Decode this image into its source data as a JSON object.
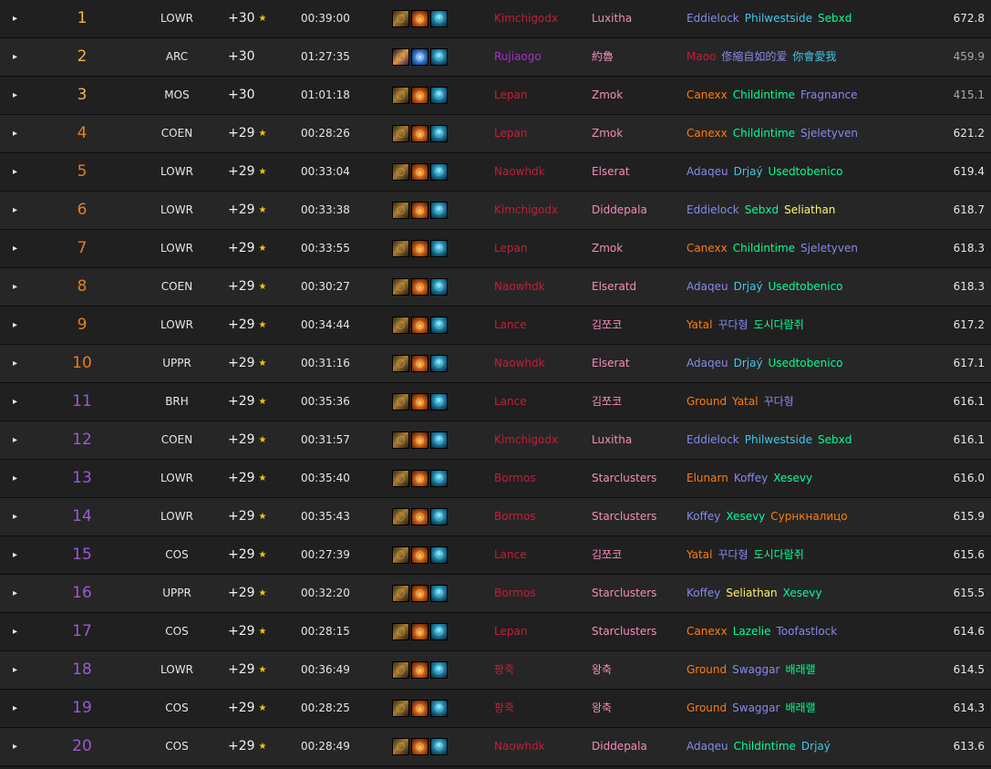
{
  "colors": {
    "rank_1": "#f5b041",
    "rank_2": "#e67e22",
    "rank_3": "#8e44ad",
    "deathknight": "#c41e3a",
    "demonhunter": "#a330c9",
    "warrior": "#c69b6d",
    "paladin": "#f48cba",
    "monk": "#00ff98",
    "druid": "#ff7c0a",
    "warlock": "#8788ee",
    "mage": "#3fc7eb",
    "priest": "#ffffff",
    "evoker": "#33937f",
    "shaman": "#0070dd",
    "rogue": "#fff468",
    "hunter": "#aad372"
  },
  "rows": [
    {
      "rank": "1",
      "rank_color": "#f0b44a",
      "dungeon": "LOWR",
      "level": "+30",
      "timed": true,
      "time": "00:39:00",
      "affix_set": "a",
      "tank": "Kimchigodx",
      "tank_color": "#c41e3a",
      "healer": "Luxitha",
      "healer_color": "#f48cba",
      "dps": [
        {
          "name": "Eddielock",
          "color": "#8788ee"
        },
        {
          "name": "Philwestside",
          "color": "#3fc7eb"
        },
        {
          "name": "Sebxd",
          "color": "#00ff98"
        }
      ],
      "score": "672.8",
      "score_dim": false
    },
    {
      "rank": "2",
      "rank_color": "#f0b44a",
      "dungeon": "ARC",
      "level": "+30",
      "timed": false,
      "time": "01:27:35",
      "affix_set": "b",
      "tank": "Rujiaogo",
      "tank_color": "#a330c9",
      "healer": "約魯",
      "healer_color": "#f48cba",
      "dps": [
        {
          "name": "Maoo",
          "color": "#c41e3a"
        },
        {
          "name": "俢縮自如的爱",
          "color": "#8788ee"
        },
        {
          "name": "你會愛我",
          "color": "#3fc7eb"
        }
      ],
      "score": "459.9",
      "score_dim": true
    },
    {
      "rank": "3",
      "rank_color": "#f0b44a",
      "dungeon": "MOS",
      "level": "+30",
      "timed": false,
      "time": "01:01:18",
      "affix_set": "a",
      "tank": "Lepan",
      "tank_color": "#c41e3a",
      "healer": "Zmok",
      "healer_color": "#f48cba",
      "dps": [
        {
          "name": "Canexx",
          "color": "#ff7c0a"
        },
        {
          "name": "Childintime",
          "color": "#00ff98"
        },
        {
          "name": "Fragnance",
          "color": "#8788ee"
        }
      ],
      "score": "415.1",
      "score_dim": true
    },
    {
      "rank": "4",
      "rank_color": "#e67e22",
      "dungeon": "COEN",
      "level": "+29",
      "timed": true,
      "time": "00:28:26",
      "affix_set": "a",
      "tank": "Lepan",
      "tank_color": "#c41e3a",
      "healer": "Zmok",
      "healer_color": "#f48cba",
      "dps": [
        {
          "name": "Canexx",
          "color": "#ff7c0a"
        },
        {
          "name": "Childintime",
          "color": "#00ff98"
        },
        {
          "name": "Sjeletyven",
          "color": "#8788ee"
        }
      ],
      "score": "621.2",
      "score_dim": false
    },
    {
      "rank": "5",
      "rank_color": "#e67e22",
      "dungeon": "LOWR",
      "level": "+29",
      "timed": true,
      "time": "00:33:04",
      "affix_set": "a",
      "tank": "Naowhdk",
      "tank_color": "#c41e3a",
      "healer": "Elserat",
      "healer_color": "#f48cba",
      "dps": [
        {
          "name": "Adaqeu",
          "color": "#8788ee"
        },
        {
          "name": "Drjaý",
          "color": "#3fc7eb"
        },
        {
          "name": "Usedtobenico",
          "color": "#00ff98"
        }
      ],
      "score": "619.4",
      "score_dim": false
    },
    {
      "rank": "6",
      "rank_color": "#e67e22",
      "dungeon": "LOWR",
      "level": "+29",
      "timed": true,
      "time": "00:33:38",
      "affix_set": "a",
      "tank": "Kimchigodx",
      "tank_color": "#c41e3a",
      "healer": "Diddepala",
      "healer_color": "#f48cba",
      "dps": [
        {
          "name": "Eddielock",
          "color": "#8788ee"
        },
        {
          "name": "Sebxd",
          "color": "#00ff98"
        },
        {
          "name": "Seliathan",
          "color": "#fff468"
        }
      ],
      "score": "618.7",
      "score_dim": false
    },
    {
      "rank": "7",
      "rank_color": "#e67e22",
      "dungeon": "LOWR",
      "level": "+29",
      "timed": true,
      "time": "00:33:55",
      "affix_set": "a",
      "tank": "Lepan",
      "tank_color": "#c41e3a",
      "healer": "Zmok",
      "healer_color": "#f48cba",
      "dps": [
        {
          "name": "Canexx",
          "color": "#ff7c0a"
        },
        {
          "name": "Childintime",
          "color": "#00ff98"
        },
        {
          "name": "Sjeletyven",
          "color": "#8788ee"
        }
      ],
      "score": "618.3",
      "score_dim": false
    },
    {
      "rank": "8",
      "rank_color": "#e67e22",
      "dungeon": "COEN",
      "level": "+29",
      "timed": true,
      "time": "00:30:27",
      "affix_set": "a",
      "tank": "Naowhdk",
      "tank_color": "#c41e3a",
      "healer": "Elseratd",
      "healer_color": "#f48cba",
      "dps": [
        {
          "name": "Adaqeu",
          "color": "#8788ee"
        },
        {
          "name": "Drjaý",
          "color": "#3fc7eb"
        },
        {
          "name": "Usedtobenico",
          "color": "#00ff98"
        }
      ],
      "score": "618.3",
      "score_dim": false
    },
    {
      "rank": "9",
      "rank_color": "#e67e22",
      "dungeon": "LOWR",
      "level": "+29",
      "timed": true,
      "time": "00:34:44",
      "affix_set": "a",
      "tank": "Lance",
      "tank_color": "#c41e3a",
      "healer": "김쪼코",
      "healer_color": "#f48cba",
      "dps": [
        {
          "name": "Yatal",
          "color": "#ff7c0a"
        },
        {
          "name": "꾸다형",
          "color": "#8788ee"
        },
        {
          "name": "도시다람쥐",
          "color": "#00ff98"
        }
      ],
      "score": "617.2",
      "score_dim": false
    },
    {
      "rank": "10",
      "rank_color": "#e67e22",
      "dungeon": "UPPR",
      "level": "+29",
      "timed": true,
      "time": "00:31:16",
      "affix_set": "a",
      "tank": "Naowhdk",
      "tank_color": "#c41e3a",
      "healer": "Elserat",
      "healer_color": "#f48cba",
      "dps": [
        {
          "name": "Adaqeu",
          "color": "#8788ee"
        },
        {
          "name": "Drjaý",
          "color": "#3fc7eb"
        },
        {
          "name": "Usedtobenico",
          "color": "#00ff98"
        }
      ],
      "score": "617.1",
      "score_dim": false
    },
    {
      "rank": "11",
      "rank_color": "#9b59d6",
      "dungeon": "BRH",
      "level": "+29",
      "timed": true,
      "time": "00:35:36",
      "affix_set": "a",
      "tank": "Lance",
      "tank_color": "#c41e3a",
      "healer": "김쪼코",
      "healer_color": "#f48cba",
      "dps": [
        {
          "name": "Ground",
          "color": "#ff7c0a"
        },
        {
          "name": "Yatal",
          "color": "#ff7c0a"
        },
        {
          "name": "꾸다형",
          "color": "#8788ee"
        }
      ],
      "score": "616.1",
      "score_dim": false
    },
    {
      "rank": "12",
      "rank_color": "#9b59d6",
      "dungeon": "COEN",
      "level": "+29",
      "timed": true,
      "time": "00:31:57",
      "affix_set": "a",
      "tank": "Kimchigodx",
      "tank_color": "#c41e3a",
      "healer": "Luxitha",
      "healer_color": "#f48cba",
      "dps": [
        {
          "name": "Eddielock",
          "color": "#8788ee"
        },
        {
          "name": "Philwestside",
          "color": "#3fc7eb"
        },
        {
          "name": "Sebxd",
          "color": "#00ff98"
        }
      ],
      "score": "616.1",
      "score_dim": false
    },
    {
      "rank": "13",
      "rank_color": "#9b59d6",
      "dungeon": "LOWR",
      "level": "+29",
      "timed": true,
      "time": "00:35:40",
      "affix_set": "a",
      "tank": "Bormos",
      "tank_color": "#c41e3a",
      "healer": "Starclusters",
      "healer_color": "#f48cba",
      "dps": [
        {
          "name": "Elunarn",
          "color": "#ff7c0a"
        },
        {
          "name": "Koffey",
          "color": "#8788ee"
        },
        {
          "name": "Xesevy",
          "color": "#00ff98"
        }
      ],
      "score": "616.0",
      "score_dim": false
    },
    {
      "rank": "14",
      "rank_color": "#9b59d6",
      "dungeon": "LOWR",
      "level": "+29",
      "timed": true,
      "time": "00:35:43",
      "affix_set": "a",
      "tank": "Bormos",
      "tank_color": "#c41e3a",
      "healer": "Starclusters",
      "healer_color": "#f48cba",
      "dps": [
        {
          "name": "Koffey",
          "color": "#8788ee"
        },
        {
          "name": "Xesevy",
          "color": "#00ff98"
        },
        {
          "name": "Сурнкналицо",
          "color": "#ff7c0a"
        }
      ],
      "score": "615.9",
      "score_dim": false
    },
    {
      "rank": "15",
      "rank_color": "#9b59d6",
      "dungeon": "COS",
      "level": "+29",
      "timed": true,
      "time": "00:27:39",
      "affix_set": "a",
      "tank": "Lance",
      "tank_color": "#c41e3a",
      "healer": "김쪼코",
      "healer_color": "#f48cba",
      "dps": [
        {
          "name": "Yatal",
          "color": "#ff7c0a"
        },
        {
          "name": "꾸다형",
          "color": "#8788ee"
        },
        {
          "name": "도시다람쥐",
          "color": "#00ff98"
        }
      ],
      "score": "615.6",
      "score_dim": false
    },
    {
      "rank": "16",
      "rank_color": "#9b59d6",
      "dungeon": "UPPR",
      "level": "+29",
      "timed": true,
      "time": "00:32:20",
      "affix_set": "a",
      "tank": "Bormos",
      "tank_color": "#c41e3a",
      "healer": "Starclusters",
      "healer_color": "#f48cba",
      "dps": [
        {
          "name": "Koffey",
          "color": "#8788ee"
        },
        {
          "name": "Seliathan",
          "color": "#fff468"
        },
        {
          "name": "Xesevy",
          "color": "#00ff98"
        }
      ],
      "score": "615.5",
      "score_dim": false
    },
    {
      "rank": "17",
      "rank_color": "#9b59d6",
      "dungeon": "COS",
      "level": "+29",
      "timed": true,
      "time": "00:28:15",
      "affix_set": "a",
      "tank": "Lepan",
      "tank_color": "#c41e3a",
      "healer": "Starclusters",
      "healer_color": "#f48cba",
      "dps": [
        {
          "name": "Canexx",
          "color": "#ff7c0a"
        },
        {
          "name": "Lazelie",
          "color": "#00ff98"
        },
        {
          "name": "Toofastlock",
          "color": "#8788ee"
        }
      ],
      "score": "614.6",
      "score_dim": false
    },
    {
      "rank": "18",
      "rank_color": "#9b59d6",
      "dungeon": "LOWR",
      "level": "+29",
      "timed": true,
      "time": "00:36:49",
      "affix_set": "a",
      "tank": "팡죽",
      "tank_color": "#c41e3a",
      "healer": "왕축",
      "healer_color": "#f48cba",
      "dps": [
        {
          "name": "Ground",
          "color": "#ff7c0a"
        },
        {
          "name": "Swaggar",
          "color": "#8788ee"
        },
        {
          "name": "배래랠",
          "color": "#00ff98"
        }
      ],
      "score": "614.5",
      "score_dim": false
    },
    {
      "rank": "19",
      "rank_color": "#9b59d6",
      "dungeon": "COS",
      "level": "+29",
      "timed": true,
      "time": "00:28:25",
      "affix_set": "a",
      "tank": "팡죽",
      "tank_color": "#c41e3a",
      "healer": "왕축",
      "healer_color": "#f48cba",
      "dps": [
        {
          "name": "Ground",
          "color": "#ff7c0a"
        },
        {
          "name": "Swaggar",
          "color": "#8788ee"
        },
        {
          "name": "배래랠",
          "color": "#00ff98"
        }
      ],
      "score": "614.3",
      "score_dim": false
    },
    {
      "rank": "20",
      "rank_color": "#9b59d6",
      "dungeon": "COS",
      "level": "+29",
      "timed": true,
      "time": "00:28:49",
      "affix_set": "a",
      "tank": "Naowhdk",
      "tank_color": "#c41e3a",
      "healer": "Diddepala",
      "healer_color": "#f48cba",
      "dps": [
        {
          "name": "Adaqeu",
          "color": "#8788ee"
        },
        {
          "name": "Childintime",
          "color": "#00ff98"
        },
        {
          "name": "Drjaý",
          "color": "#3fc7eb"
        }
      ],
      "score": "613.6",
      "score_dim": false
    }
  ],
  "icons": {
    "expand": "caret-right-icon",
    "timed": "star-icon",
    "affix_set_a": [
      "tyrannical-icon",
      "explosive-icon",
      "quaking-icon"
    ],
    "affix_set_b": [
      "fortified-icon",
      "bolstering-icon",
      "quaking-icon"
    ]
  },
  "glyphs": {
    "expand": "▸",
    "star": "★"
  }
}
